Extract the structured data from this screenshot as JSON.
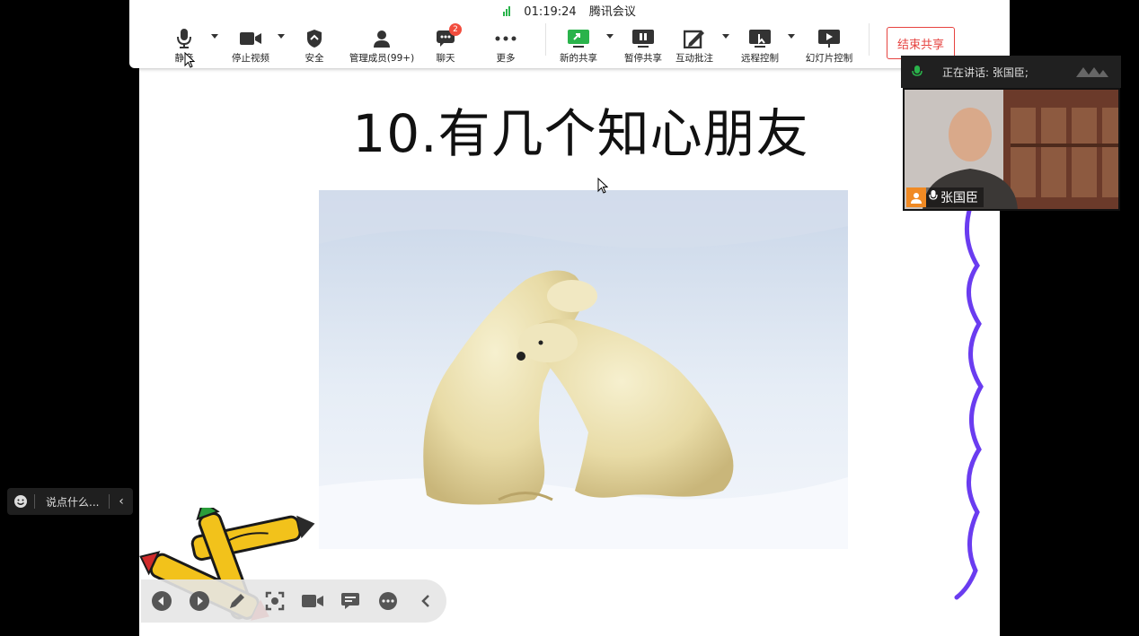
{
  "meeting": {
    "timer": "01:19:24",
    "app_name": "腾讯会议"
  },
  "toolbar": {
    "mute_label": "静音",
    "stop_video_label": "停止视频",
    "security_label": "安全",
    "manage_members_label": "管理成员(99+)",
    "chat_label": "聊天",
    "chat_badge": "2",
    "more_label": "更多",
    "new_share_label": "新的共享",
    "pause_share_label": "暂停共享",
    "annotate_label": "互动批注",
    "remote_control_label": "远程控制",
    "slideshow_control_label": "幻灯片控制",
    "end_share_label": "结束共享"
  },
  "speaker": {
    "speaking_text": "正在讲话: 张国臣;",
    "name": "张国臣"
  },
  "slide": {
    "title": "10.有几个知心朋友"
  },
  "chat_input": {
    "placeholder": "说点什么..."
  },
  "colors": {
    "accent_green": "#2ab34b",
    "end_share_red": "#e64340",
    "wavy_line": "#6a3cf0",
    "badge_red": "#f24c3d"
  }
}
